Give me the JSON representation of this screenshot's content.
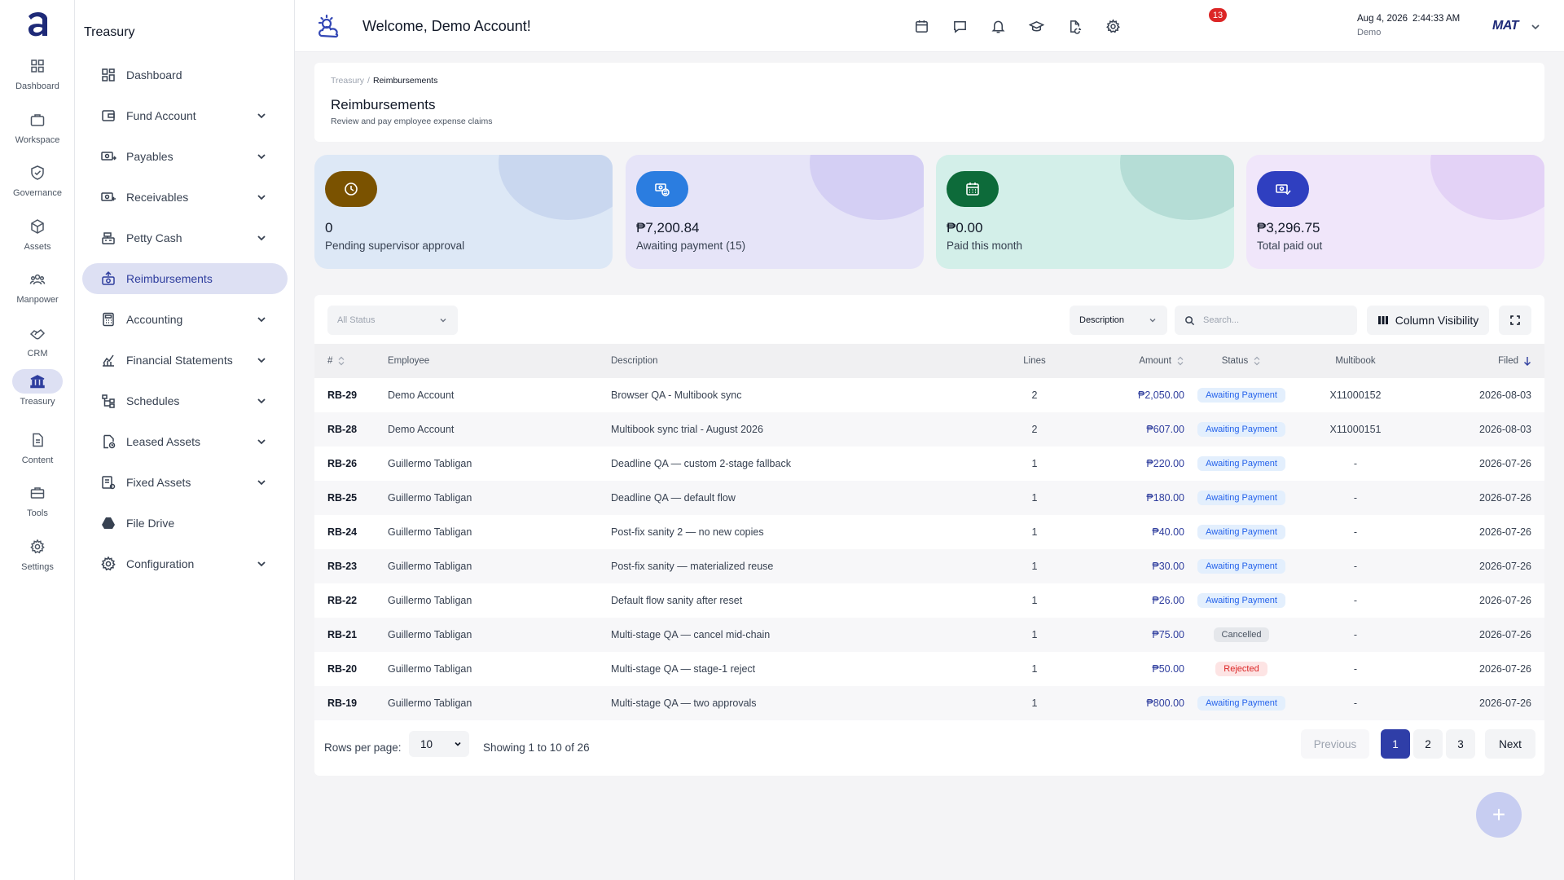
{
  "rail": [
    {
      "label": "Dashboard",
      "icon": "grid-icon"
    },
    {
      "label": "Workspace",
      "icon": "briefcase-icon"
    },
    {
      "label": "Governance",
      "icon": "shield-icon"
    },
    {
      "label": "Assets",
      "icon": "box-icon"
    },
    {
      "label": "Manpower",
      "icon": "people-icon"
    },
    {
      "label": "CRM",
      "icon": "handshake-icon"
    },
    {
      "label": "Treasury",
      "icon": "bank-icon",
      "active": true
    },
    {
      "label": "Content",
      "icon": "document-icon"
    },
    {
      "label": "Tools",
      "icon": "toolbox-icon"
    },
    {
      "label": "Settings",
      "icon": "gear-icon"
    }
  ],
  "sidebar": {
    "title": "Treasury",
    "items": [
      {
        "label": "Dashboard",
        "expandable": false
      },
      {
        "label": "Fund Account",
        "expandable": true
      },
      {
        "label": "Payables",
        "expandable": true
      },
      {
        "label": "Receivables",
        "expandable": true
      },
      {
        "label": "Petty Cash",
        "expandable": true
      },
      {
        "label": "Reimbursements",
        "expandable": false,
        "active": true
      },
      {
        "label": "Accounting",
        "expandable": true
      },
      {
        "label": "Financial Statements",
        "expandable": true
      },
      {
        "label": "Schedules",
        "expandable": true
      },
      {
        "label": "Leased Assets",
        "expandable": true
      },
      {
        "label": "Fixed Assets",
        "expandable": true
      },
      {
        "label": "File Drive",
        "expandable": false
      },
      {
        "label": "Configuration",
        "expandable": true
      }
    ]
  },
  "topbar": {
    "welcome": "Welcome, Demo Account!",
    "notification_count": "13",
    "date": "Aug 4, 2026",
    "time": "2:44:33 AM",
    "account": "Demo",
    "brand": "MAT"
  },
  "header": {
    "breadcrumb_root": "Treasury",
    "breadcrumb_sep": "/",
    "breadcrumb_current": "Reimbursements",
    "title": "Reimbursements",
    "subtitle": "Review and pay employee expense claims"
  },
  "stats": [
    {
      "value": "0",
      "label": "Pending supervisor approval",
      "bg": "#dde8f6",
      "blob": "#c9d7ef",
      "icon_bg": "#7a5200"
    },
    {
      "value": "₱7,200.84",
      "label": "Awaiting payment (15)",
      "bg": "#e6e4f8",
      "blob": "#d4cff4",
      "icon_bg": "#2b7de0"
    },
    {
      "value": "₱0.00",
      "label": "Paid this month",
      "bg": "#d3efe9",
      "blob": "#b5ddd6",
      "icon_bg": "#0d6b3a"
    },
    {
      "value": "₱3,296.75",
      "label": "Total paid out",
      "bg": "#f0e6fa",
      "blob": "#e3d2f6",
      "icon_bg": "#2f3fc0"
    }
  ],
  "filters": {
    "status_placeholder": "All Status",
    "search_field": "Description",
    "search_placeholder": "Search...",
    "column_visibility": "Column Visibility"
  },
  "table": {
    "columns": {
      "id": "#",
      "employee": "Employee",
      "description": "Description",
      "lines": "Lines",
      "amount": "Amount",
      "status": "Status",
      "multibook": "Multibook",
      "filed": "Filed"
    },
    "rows": [
      {
        "id": "RB-29",
        "employee": "Demo Account",
        "description": "Browser QA - Multibook sync",
        "lines": "2",
        "amount": "₱2,050.00",
        "status": "Awaiting Payment",
        "multibook": "X11000152",
        "filed": "2026-08-03"
      },
      {
        "id": "RB-28",
        "employee": "Demo Account",
        "description": "Multibook sync trial - August 2026",
        "lines": "2",
        "amount": "₱607.00",
        "status": "Awaiting Payment",
        "multibook": "X11000151",
        "filed": "2026-08-03"
      },
      {
        "id": "RB-26",
        "employee": "Guillermo Tabligan",
        "description": "Deadline QA — custom 2-stage fallback",
        "lines": "1",
        "amount": "₱220.00",
        "status": "Awaiting Payment",
        "multibook": "-",
        "filed": "2026-07-26"
      },
      {
        "id": "RB-25",
        "employee": "Guillermo Tabligan",
        "description": "Deadline QA — default flow",
        "lines": "1",
        "amount": "₱180.00",
        "status": "Awaiting Payment",
        "multibook": "-",
        "filed": "2026-07-26"
      },
      {
        "id": "RB-24",
        "employee": "Guillermo Tabligan",
        "description": "Post-fix sanity 2 — no new copies",
        "lines": "1",
        "amount": "₱40.00",
        "status": "Awaiting Payment",
        "multibook": "-",
        "filed": "2026-07-26"
      },
      {
        "id": "RB-23",
        "employee": "Guillermo Tabligan",
        "description": "Post-fix sanity — materialized reuse",
        "lines": "1",
        "amount": "₱30.00",
        "status": "Awaiting Payment",
        "multibook": "-",
        "filed": "2026-07-26"
      },
      {
        "id": "RB-22",
        "employee": "Guillermo Tabligan",
        "description": "Default flow sanity after reset",
        "lines": "1",
        "amount": "₱26.00",
        "status": "Awaiting Payment",
        "multibook": "-",
        "filed": "2026-07-26"
      },
      {
        "id": "RB-21",
        "employee": "Guillermo Tabligan",
        "description": "Multi-stage QA — cancel mid-chain",
        "lines": "1",
        "amount": "₱75.00",
        "status": "Cancelled",
        "multibook": "-",
        "filed": "2026-07-26"
      },
      {
        "id": "RB-20",
        "employee": "Guillermo Tabligan",
        "description": "Multi-stage QA — stage-1 reject",
        "lines": "1",
        "amount": "₱50.00",
        "status": "Rejected",
        "multibook": "-",
        "filed": "2026-07-26"
      },
      {
        "id": "RB-19",
        "employee": "Guillermo Tabligan",
        "description": "Multi-stage QA — two approvals",
        "lines": "1",
        "amount": "₱800.00",
        "status": "Awaiting Payment",
        "multibook": "-",
        "filed": "2026-07-26"
      }
    ]
  },
  "pagination": {
    "rows_per_page_label": "Rows per page:",
    "rows_per_page": "10",
    "showing": "Showing 1 to 10 of 26",
    "previous": "Previous",
    "pages": [
      "1",
      "2",
      "3"
    ],
    "current_page": "1",
    "next": "Next"
  },
  "fab_label": "+"
}
